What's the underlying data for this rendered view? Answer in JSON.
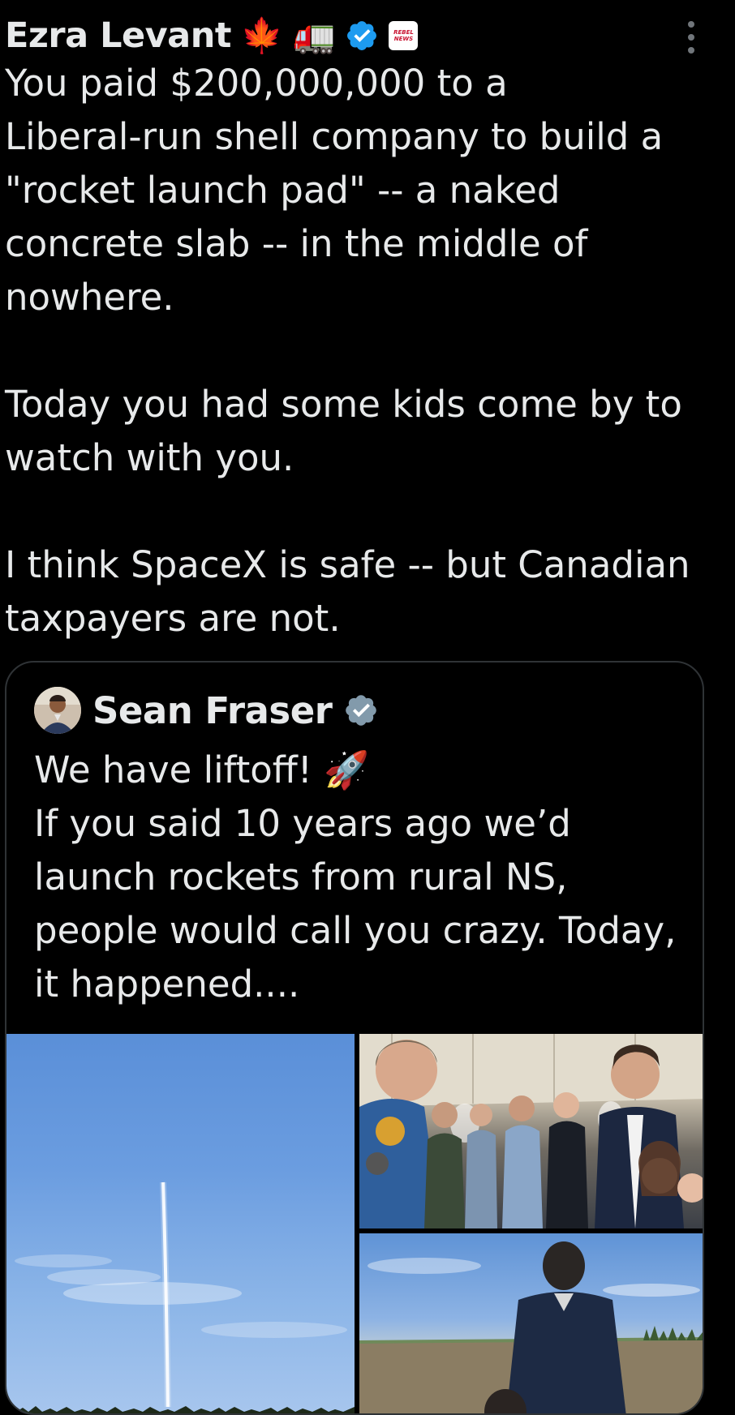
{
  "author": {
    "name": "Ezra Levant",
    "emoji_1": "🍁",
    "emoji_2": "🚛",
    "verified_icon": "verified-badge-icon",
    "affiliation_badge_text_1": "REBEL",
    "affiliation_badge_text_2": "NEWS"
  },
  "post": {
    "text": "You paid $200,000,000 to a\nLiberal-run shell company to build a\n\"rocket launch pad\" -- a naked\nconcrete slab -- in the middle of\nnowhere.\n\nToday you had some kids come by to\nwatch with you.\n\nI think SpaceX is safe -- but Canadian\ntaxpayers are not."
  },
  "quote": {
    "name": "Sean Fraser",
    "lines": [
      "We have liftoff! 🚀",
      "If you said 10 years ago we’d",
      "launch rockets from rural NS,",
      "people would call you crazy. Today,",
      "it happened...."
    ]
  },
  "colors": {
    "background": "#000000",
    "text": "#e7e9ea",
    "verified_blue": "#1d9bf0",
    "verified_grey": "#829aab",
    "border": "#2f3336"
  }
}
